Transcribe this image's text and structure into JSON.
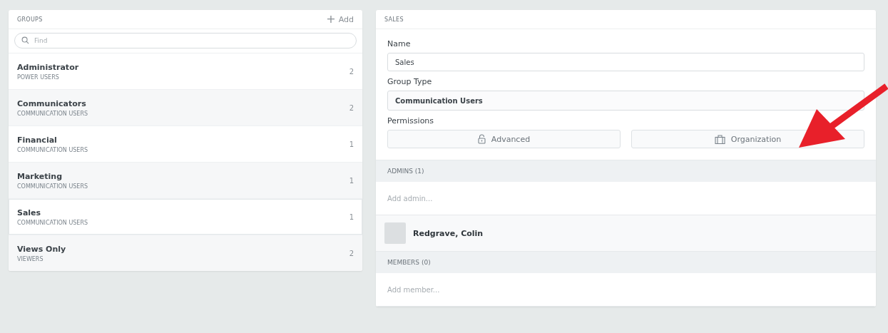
{
  "groups_panel": {
    "title": "GROUPS",
    "add_button": {
      "icon": "+",
      "label": "Add"
    },
    "search": {
      "placeholder": "Find"
    },
    "items": [
      {
        "name": "Administrator",
        "type": "POWER USERS",
        "count": "2",
        "selected": false
      },
      {
        "name": "Communicators",
        "type": "COMMUNICATION USERS",
        "count": "2",
        "selected": false
      },
      {
        "name": "Financial",
        "type": "COMMUNICATION USERS",
        "count": "1",
        "selected": false
      },
      {
        "name": "Marketing",
        "type": "COMMUNICATION USERS",
        "count": "1",
        "selected": false
      },
      {
        "name": "Sales",
        "type": "COMMUNICATION USERS",
        "count": "1",
        "selected": true
      },
      {
        "name": "Views Only",
        "type": "VIEWERS",
        "count": "2",
        "selected": false
      }
    ]
  },
  "detail_panel": {
    "title": "SALES",
    "name_label": "Name",
    "name_value": "Sales",
    "group_type_label": "Group Type",
    "group_type_value": "Communication Users",
    "permissions_label": "Permissions",
    "permission_buttons": [
      {
        "kind": "lock",
        "label": "Advanced"
      },
      {
        "kind": "briefcase",
        "label": "Organization"
      }
    ],
    "admins": {
      "title": "ADMINS (1)",
      "placeholder": "Add admin...",
      "people": [
        {
          "name": "Redgrave, Colin"
        }
      ]
    },
    "members": {
      "title": "MEMBERS (0)",
      "placeholder": "Add member..."
    }
  }
}
